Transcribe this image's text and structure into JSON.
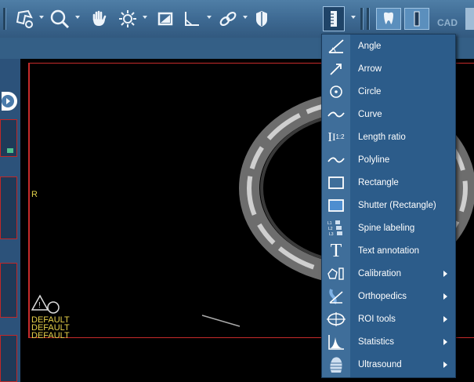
{
  "viewer": {
    "orientation_label": "R",
    "overlay_lines": [
      "DEFAULT",
      "DEFAULT",
      "DEFAULT"
    ],
    "cad_label": "CAD",
    "colors": {
      "menu_bg": "#2c5c8a",
      "menu_icon_col": "#3f6e9a",
      "toolbar": "#3e6a93",
      "overlay_text": "#e8d24a",
      "frame_red": "#c62b2b"
    }
  },
  "toolbar": {
    "icons": [
      "layout-icon",
      "zoom-icon",
      "pan-hand-icon",
      "brightness-icon",
      "window-level-icon",
      "angle-tool-icon",
      "link-icon",
      "shield-icon",
      "annotation-ruler-icon",
      "tooth-icon",
      "implant-icon",
      "cad-icon"
    ]
  },
  "menu": {
    "items": [
      {
        "label": "Angle",
        "icon": "angle-icon",
        "submenu": false
      },
      {
        "label": "Arrow",
        "icon": "arrow-icon",
        "submenu": false
      },
      {
        "label": "Circle",
        "icon": "circle-icon",
        "submenu": false
      },
      {
        "label": "Curve",
        "icon": "curve-icon",
        "submenu": false
      },
      {
        "label": "Length ratio",
        "icon": "length-ratio-icon",
        "submenu": false,
        "icon_text": "1:2"
      },
      {
        "label": "Polyline",
        "icon": "polyline-icon",
        "submenu": false
      },
      {
        "label": "Rectangle",
        "icon": "rectangle-icon",
        "submenu": false
      },
      {
        "label": "Shutter (Rectangle)",
        "icon": "shutter-icon",
        "submenu": false
      },
      {
        "label": "Spine labeling",
        "icon": "spine-icon",
        "submenu": false,
        "icon_text": [
          "L1",
          "L2",
          "L3"
        ]
      },
      {
        "label": "Text annotation",
        "icon": "text-icon",
        "submenu": false,
        "icon_text": "T"
      },
      {
        "label": "Calibration",
        "icon": "calibration-icon",
        "submenu": true
      },
      {
        "label": "Orthopedics",
        "icon": "orthopedics-icon",
        "submenu": true
      },
      {
        "label": "ROI tools",
        "icon": "roi-icon",
        "submenu": true
      },
      {
        "label": "Statistics",
        "icon": "statistics-icon",
        "submenu": true
      },
      {
        "label": "Ultrasound",
        "icon": "ultrasound-icon",
        "submenu": true
      }
    ]
  }
}
